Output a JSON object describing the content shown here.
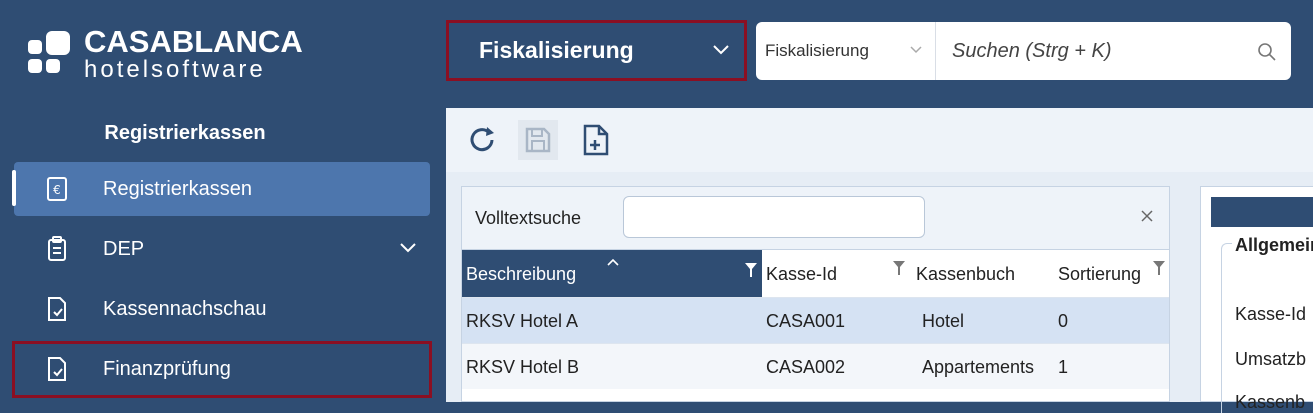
{
  "brand": {
    "line1": "CASABLANCA",
    "line2": "hotelsoftware"
  },
  "sidebar": {
    "title": "Registrierkassen",
    "items": [
      {
        "label": "Registrierkassen",
        "icon": "euro-receipt-icon",
        "active": true
      },
      {
        "label": "DEP",
        "icon": "clipboard-list-icon",
        "expandable": true
      },
      {
        "label": "Kassennachschau",
        "icon": "document-check-icon"
      },
      {
        "label": "Finanzprüfung",
        "icon": "document-check-icon"
      }
    ]
  },
  "header": {
    "module": "Fiskalisierung",
    "search": {
      "scope": "Fiskalisierung",
      "placeholder": "Suchen (Strg + K)"
    }
  },
  "toolbar": {
    "buttons": [
      "refresh-icon",
      "save-icon",
      "new-document-icon"
    ]
  },
  "grid": {
    "filter_label": "Volltextsuche",
    "filter_value": "",
    "columns": [
      "Beschreibung",
      "Kasse-Id",
      "Kassenbuch",
      "Sortierung"
    ],
    "rows": [
      {
        "beschreibung": "RKSV Hotel A",
        "kasse_id": "CASA001",
        "kassenbuch": "Hotel",
        "sortierung": "0"
      },
      {
        "beschreibung": "RKSV Hotel B",
        "kasse_id": "CASA002",
        "kassenbuch": "Appartements",
        "sortierung": "1"
      }
    ]
  },
  "detail": {
    "section": "Allgemein",
    "labels": [
      "Kasse-Id",
      "Umsatzb",
      "Kassenb"
    ]
  },
  "colors": {
    "navy": "#2f4d73",
    "active": "#4d76ad",
    "highlight": "#8b0f22",
    "selected_row": "#d5e2f3"
  }
}
